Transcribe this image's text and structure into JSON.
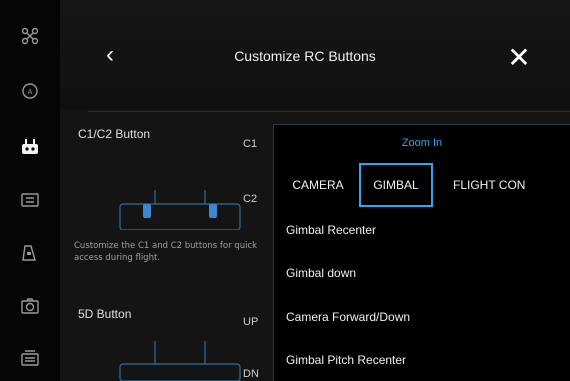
{
  "sidebar": {
    "icons": [
      "drone-icon",
      "camera-capture-icon",
      "rc-controller-icon",
      "screen-icon",
      "vehicle-icon",
      "camera-icon",
      "storage-icon"
    ]
  },
  "header": {
    "back_glyph": "‹",
    "title": "Customize RC Buttons",
    "close_glyph": "✕"
  },
  "sections": {
    "c1c2": {
      "title": "C1/C2 Button",
      "rows": [
        "C1",
        "C2"
      ],
      "description": "Customize the C1 and C2 buttons for quick access during flight."
    },
    "five_d": {
      "title": "5D Button",
      "rows": [
        "UP",
        "DN"
      ]
    }
  },
  "dropdown": {
    "label": "Zoom In",
    "tabs": [
      "CAMERA",
      "GIMBAL",
      "FLIGHT CON"
    ],
    "active_tab": 1,
    "items": [
      "Gimbal Recenter",
      "Gimbal down",
      "Camera Forward/Down",
      "Gimbal Pitch Recenter"
    ]
  },
  "colors": {
    "accent": "#2aa7f2",
    "background": "#141414",
    "panel": "#000000"
  }
}
